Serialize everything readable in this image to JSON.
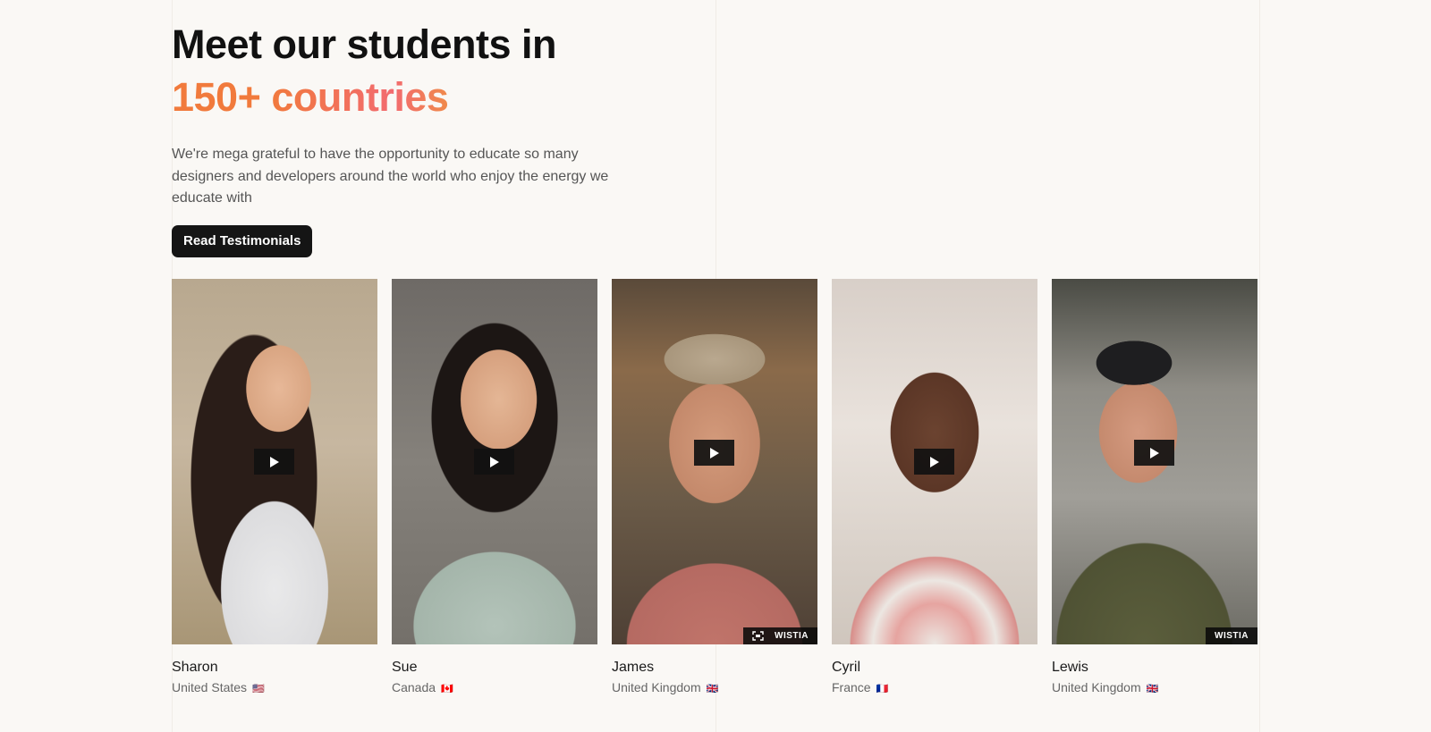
{
  "hero": {
    "title_line1": "Meet our students in",
    "title_line2": "150+ countries",
    "description": "We're mega grateful to have the opportunity to educate so many designers and developers around the world who enjoy the energy we educate with",
    "cta_label": "Read Testimonials"
  },
  "colors": {
    "accent_gradient_start": "#f17a3c",
    "accent_gradient_end": "#f26b6f",
    "button_bg": "#151515",
    "page_bg": "#faf8f5"
  },
  "wistia_label": "WISTIA",
  "students": [
    {
      "name": "Sharon",
      "country": "United States",
      "flag": "🇺🇸"
    },
    {
      "name": "Sue",
      "country": "Canada",
      "flag": "🇨🇦"
    },
    {
      "name": "James",
      "country": "United Kingdom",
      "flag": "🇬🇧"
    },
    {
      "name": "Cyril",
      "country": "France",
      "flag": "🇫🇷"
    },
    {
      "name": "Lewis",
      "country": "United Kingdom",
      "flag": "🇬🇧"
    }
  ]
}
